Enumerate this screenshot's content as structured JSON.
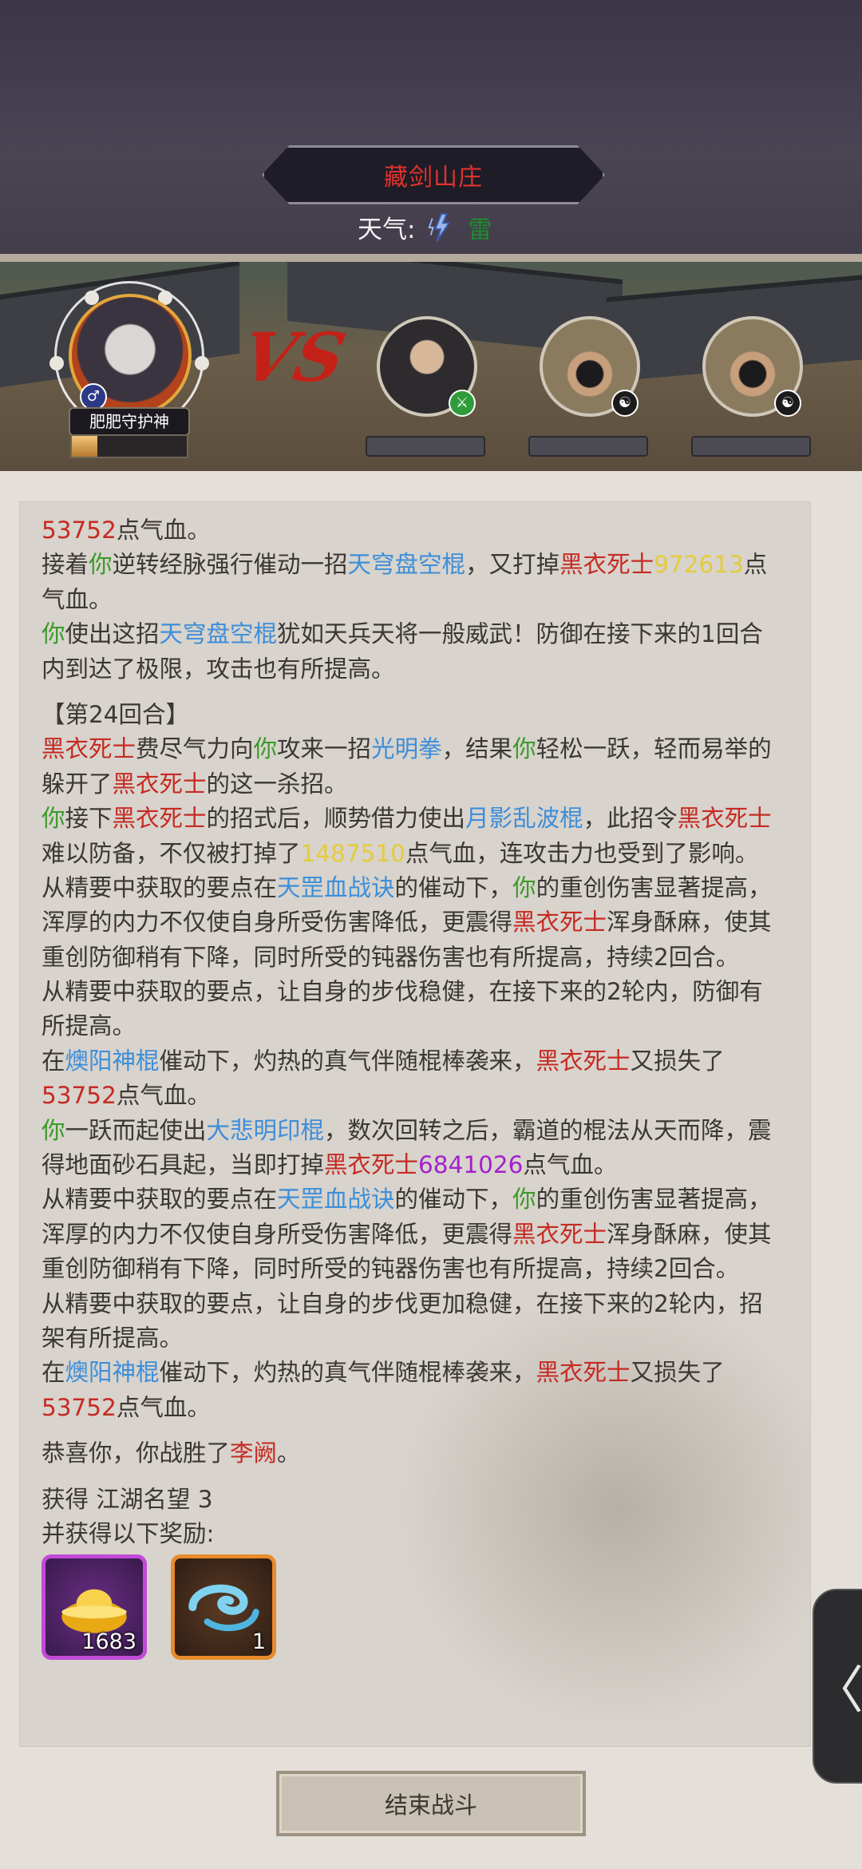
{
  "header": {
    "location_title": "藏剑山庄",
    "weather_label": "天气:",
    "weather_value": "雷",
    "weather_icon": "lightning-icon"
  },
  "battle": {
    "player_name": "肥肥守护神",
    "player_gender_icon": "male-icon",
    "vs_text": "VS",
    "player_hp_fraction": 0.22,
    "enemies": [
      {
        "portrait": "swordsman-portrait",
        "badge_icon": "sword-icon",
        "badge_color": "#2f9b3a"
      },
      {
        "portrait": "masked-hat-portrait",
        "badge_icon": "yin-yang-icon",
        "badge_color": "#1b1b1b"
      },
      {
        "portrait": "masked-hat-portrait",
        "badge_icon": "yin-yang-icon",
        "badge_color": "#1b1b1b"
      }
    ]
  },
  "log_lines": [
    [
      {
        "t": "53752",
        "c": "red"
      },
      {
        "t": "点气血。",
        "c": ""
      }
    ],
    [
      {
        "t": "接着",
        "c": ""
      },
      {
        "t": "你",
        "c": "grn"
      },
      {
        "t": "逆转经脉强行催动一招",
        "c": ""
      },
      {
        "t": "天穹盘空棍",
        "c": "blu"
      },
      {
        "t": "，又打掉",
        "c": ""
      },
      {
        "t": "黑衣死士",
        "c": "red"
      },
      {
        "t": "972613",
        "c": "yel"
      },
      {
        "t": "点",
        "c": ""
      }
    ],
    [
      {
        "t": "气血。",
        "c": ""
      }
    ],
    [
      {
        "t": "你",
        "c": "grn"
      },
      {
        "t": "使出这招",
        "c": ""
      },
      {
        "t": "天穹盘空棍",
        "c": "blu"
      },
      {
        "t": "犹如天兵天将一般威武！防御在接下来的1回合",
        "c": ""
      }
    ],
    [
      {
        "t": "内到达了极限，攻击也有所提高。",
        "c": ""
      }
    ],
    [
      {
        "t": "gap",
        "c": "gap"
      }
    ],
    [
      {
        "t": "【第24回合】",
        "c": ""
      }
    ],
    [
      {
        "t": "黑衣死士",
        "c": "red"
      },
      {
        "t": "费尽气力向",
        "c": ""
      },
      {
        "t": "你",
        "c": "grn"
      },
      {
        "t": "攻来一招",
        "c": ""
      },
      {
        "t": "光明拳",
        "c": "blu"
      },
      {
        "t": "，结果",
        "c": ""
      },
      {
        "t": "你",
        "c": "grn"
      },
      {
        "t": "轻松一跃，轻而易举的",
        "c": ""
      }
    ],
    [
      {
        "t": "躲开了",
        "c": ""
      },
      {
        "t": "黑衣死士",
        "c": "red"
      },
      {
        "t": "的这一杀招。",
        "c": ""
      }
    ],
    [
      {
        "t": "你",
        "c": "grn"
      },
      {
        "t": "接下",
        "c": ""
      },
      {
        "t": "黑衣死士",
        "c": "red"
      },
      {
        "t": "的招式后，顺势借力使出",
        "c": ""
      },
      {
        "t": "月影乱波棍",
        "c": "blu"
      },
      {
        "t": "，此招令",
        "c": ""
      },
      {
        "t": "黑衣死士",
        "c": "red"
      }
    ],
    [
      {
        "t": "难以防备，不仅被打掉了",
        "c": ""
      },
      {
        "t": "1487510",
        "c": "yel"
      },
      {
        "t": "点气血，连攻击力也受到了影响。",
        "c": ""
      }
    ],
    [
      {
        "t": "从精要中获取的要点在",
        "c": ""
      },
      {
        "t": "天罡血战诀",
        "c": "blu"
      },
      {
        "t": "的催动下，",
        "c": ""
      },
      {
        "t": "你",
        "c": "grn"
      },
      {
        "t": "的重创伤害显著提高，",
        "c": ""
      }
    ],
    [
      {
        "t": "浑厚的内力不仅使自身所受伤害降低，更震得",
        "c": ""
      },
      {
        "t": "黑衣死士",
        "c": "red"
      },
      {
        "t": "浑身酥麻，使其",
        "c": ""
      }
    ],
    [
      {
        "t": "重创防御稍有下降，同时所受的钝器伤害也有所提高，持续2回合。",
        "c": ""
      }
    ],
    [
      {
        "t": "从精要中获取的要点，让自身的步伐稳健，在接下来的2轮内，防御有",
        "c": ""
      }
    ],
    [
      {
        "t": "所提高。",
        "c": ""
      }
    ],
    [
      {
        "t": "在",
        "c": ""
      },
      {
        "t": "燠阳神棍",
        "c": "blu"
      },
      {
        "t": "催动下，灼热的真气伴随棍棒袭来，",
        "c": ""
      },
      {
        "t": "黑衣死士",
        "c": "red"
      },
      {
        "t": "又损失了",
        "c": ""
      }
    ],
    [
      {
        "t": "53752",
        "c": "red"
      },
      {
        "t": "点气血。",
        "c": ""
      }
    ],
    [
      {
        "t": "你",
        "c": "grn"
      },
      {
        "t": "一跃而起使出",
        "c": ""
      },
      {
        "t": "大悲明印棍",
        "c": "blu"
      },
      {
        "t": "，数次回转之后，霸道的棍法从天而降，震",
        "c": ""
      }
    ],
    [
      {
        "t": "得地面砂石具起，当即打掉",
        "c": ""
      },
      {
        "t": "黑衣死士",
        "c": "red"
      },
      {
        "t": "6841026",
        "c": "pur"
      },
      {
        "t": "点气血。",
        "c": ""
      }
    ],
    [
      {
        "t": "从精要中获取的要点在",
        "c": ""
      },
      {
        "t": "天罡血战诀",
        "c": "blu"
      },
      {
        "t": "的催动下，",
        "c": ""
      },
      {
        "t": "你",
        "c": "grn"
      },
      {
        "t": "的重创伤害显著提高，",
        "c": ""
      }
    ],
    [
      {
        "t": "浑厚的内力不仅使自身所受伤害降低，更震得",
        "c": ""
      },
      {
        "t": "黑衣死士",
        "c": "red"
      },
      {
        "t": "浑身酥麻，使其",
        "c": ""
      }
    ],
    [
      {
        "t": "重创防御稍有下降，同时所受的钝器伤害也有所提高，持续2回合。",
        "c": ""
      }
    ],
    [
      {
        "t": "从精要中获取的要点，让自身的步伐更加稳健，在接下来的2轮内，招",
        "c": ""
      }
    ],
    [
      {
        "t": "架有所提高。",
        "c": ""
      }
    ],
    [
      {
        "t": "在",
        "c": ""
      },
      {
        "t": "燠阳神棍",
        "c": "blu"
      },
      {
        "t": "催动下，灼热的真气伴随棍棒袭来，",
        "c": ""
      },
      {
        "t": "黑衣死士",
        "c": "red"
      },
      {
        "t": "又损失了",
        "c": ""
      }
    ],
    [
      {
        "t": "53752",
        "c": "red"
      },
      {
        "t": "点气血。",
        "c": ""
      }
    ],
    [
      {
        "t": "gap",
        "c": "gap"
      }
    ],
    [
      {
        "t": "恭喜你，你战胜了",
        "c": ""
      },
      {
        "t": "李阙",
        "c": "red"
      },
      {
        "t": "。",
        "c": ""
      }
    ],
    [
      {
        "t": "gap",
        "c": "gap"
      }
    ],
    [
      {
        "t": "获得 江湖名望 3",
        "c": ""
      }
    ],
    [
      {
        "t": "并获得以下奖励:",
        "c": ""
      }
    ]
  ],
  "rewards": [
    {
      "icon": "gold-ingot-icon",
      "count": "1683",
      "rarity_color": "#c24ad8"
    },
    {
      "icon": "cloud-swirl-icon",
      "count": "1",
      "rarity_color": "#e88b2b"
    }
  ],
  "side_tab_glyph": "〈",
  "end_button_label": "结束战斗"
}
